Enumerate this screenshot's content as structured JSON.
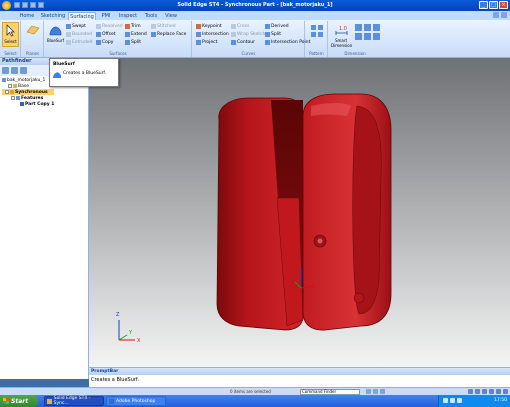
{
  "window": {
    "title": "Solid Edge ST4 - Synchronous Part - [bak_motorjaku_1]"
  },
  "ribbon": {
    "tabs": [
      "Home",
      "Sketching",
      "Surfacing",
      "PMI",
      "Inspect",
      "Tools",
      "View"
    ],
    "active_tab": "Surfacing",
    "groups": {
      "select": {
        "button": "Select",
        "label": "Select"
      },
      "planes": {
        "label": "Planes"
      },
      "surfaces": {
        "label": "Surfaces",
        "bluesurf": "BlueSurf",
        "items": [
          "Swept",
          "Bounded",
          "Extruded",
          "Offset",
          "Revolved",
          "Copy",
          "Trim",
          "Extend",
          "Replace Face",
          "Split",
          "Stitched"
        ]
      },
      "curves": {
        "label": "Curves",
        "items": [
          "Keypoint",
          "Intersection",
          "Project",
          "Cross",
          "Wrap Sketch",
          "Contour",
          "Derived",
          "Split",
          "Intersection Point"
        ]
      },
      "pattern": {
        "label": "Pattern"
      },
      "dimension": {
        "label": "Dimension",
        "button": "Smart Dimension"
      }
    }
  },
  "pathfinder": {
    "title": "Pathfinder",
    "tree": [
      "bak_motorjaku_1",
      "Base",
      "Synchronous",
      "Features",
      "Part Copy 1"
    ]
  },
  "tooltip": {
    "title": "BlueSurf",
    "description": "Creates a BlueSurf."
  },
  "viewport": {
    "axes": [
      "X",
      "Y",
      "Z"
    ],
    "colors": {
      "part": "#c3171d",
      "background_top": "#6f7275",
      "background_bottom": "#f4f4f4",
      "axis_x": "#d01010",
      "axis_y": "#18a018",
      "axis_z": "#1a3cc8"
    }
  },
  "prompt": {
    "title": "PromptBar",
    "text": "Creates a BlueSurf."
  },
  "status": {
    "selection": "0 items are selected",
    "command_finder": "Command Finder"
  },
  "taskbar": {
    "start": "Start",
    "items": [
      "Solid Edge ST4 - Sync...",
      "Adobe Photoshop"
    ],
    "clock": "17:50"
  }
}
